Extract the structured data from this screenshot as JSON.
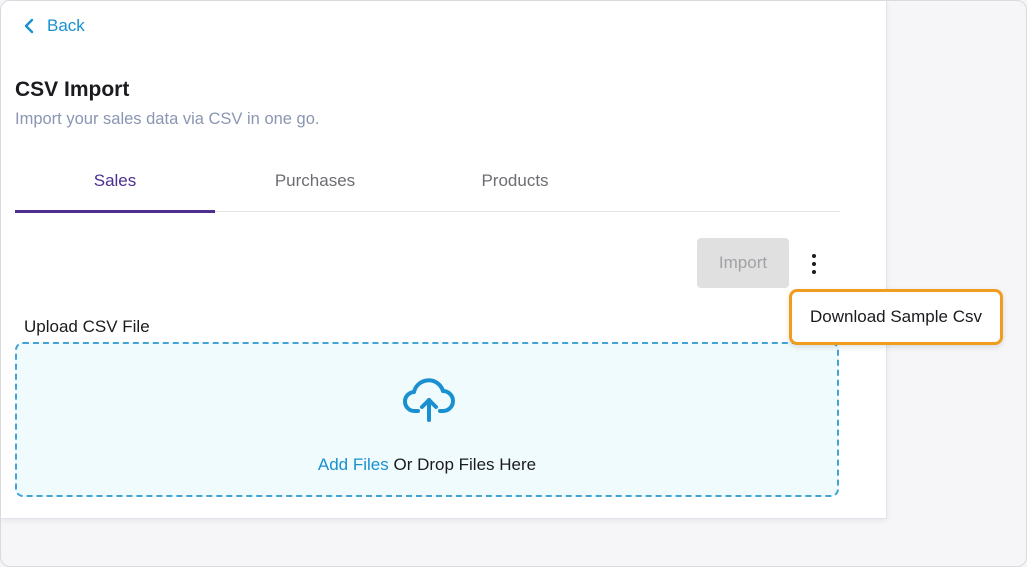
{
  "nav": {
    "back_label": "Back"
  },
  "header": {
    "title": "CSV Import",
    "subtitle": "Import your sales data via CSV in one go."
  },
  "tabs": [
    {
      "label": "Sales",
      "active": true
    },
    {
      "label": "Purchases",
      "active": false
    },
    {
      "label": "Products",
      "active": false
    }
  ],
  "actions": {
    "import_label": "Import",
    "import_disabled": true
  },
  "menu": {
    "items": [
      {
        "label": "Download Sample Csv"
      }
    ]
  },
  "upload": {
    "label": "Upload CSV File",
    "add_files_label": "Add Files",
    "drop_text": " Or Drop Files Here",
    "icon": "cloud-upload-icon"
  },
  "colors": {
    "accent": "#1a90d0",
    "tab_active": "#4d2f8f",
    "highlight": "#ef9d1c",
    "dropzone_bg": "#f0fbfd",
    "dropzone_border": "#42a3d4"
  }
}
